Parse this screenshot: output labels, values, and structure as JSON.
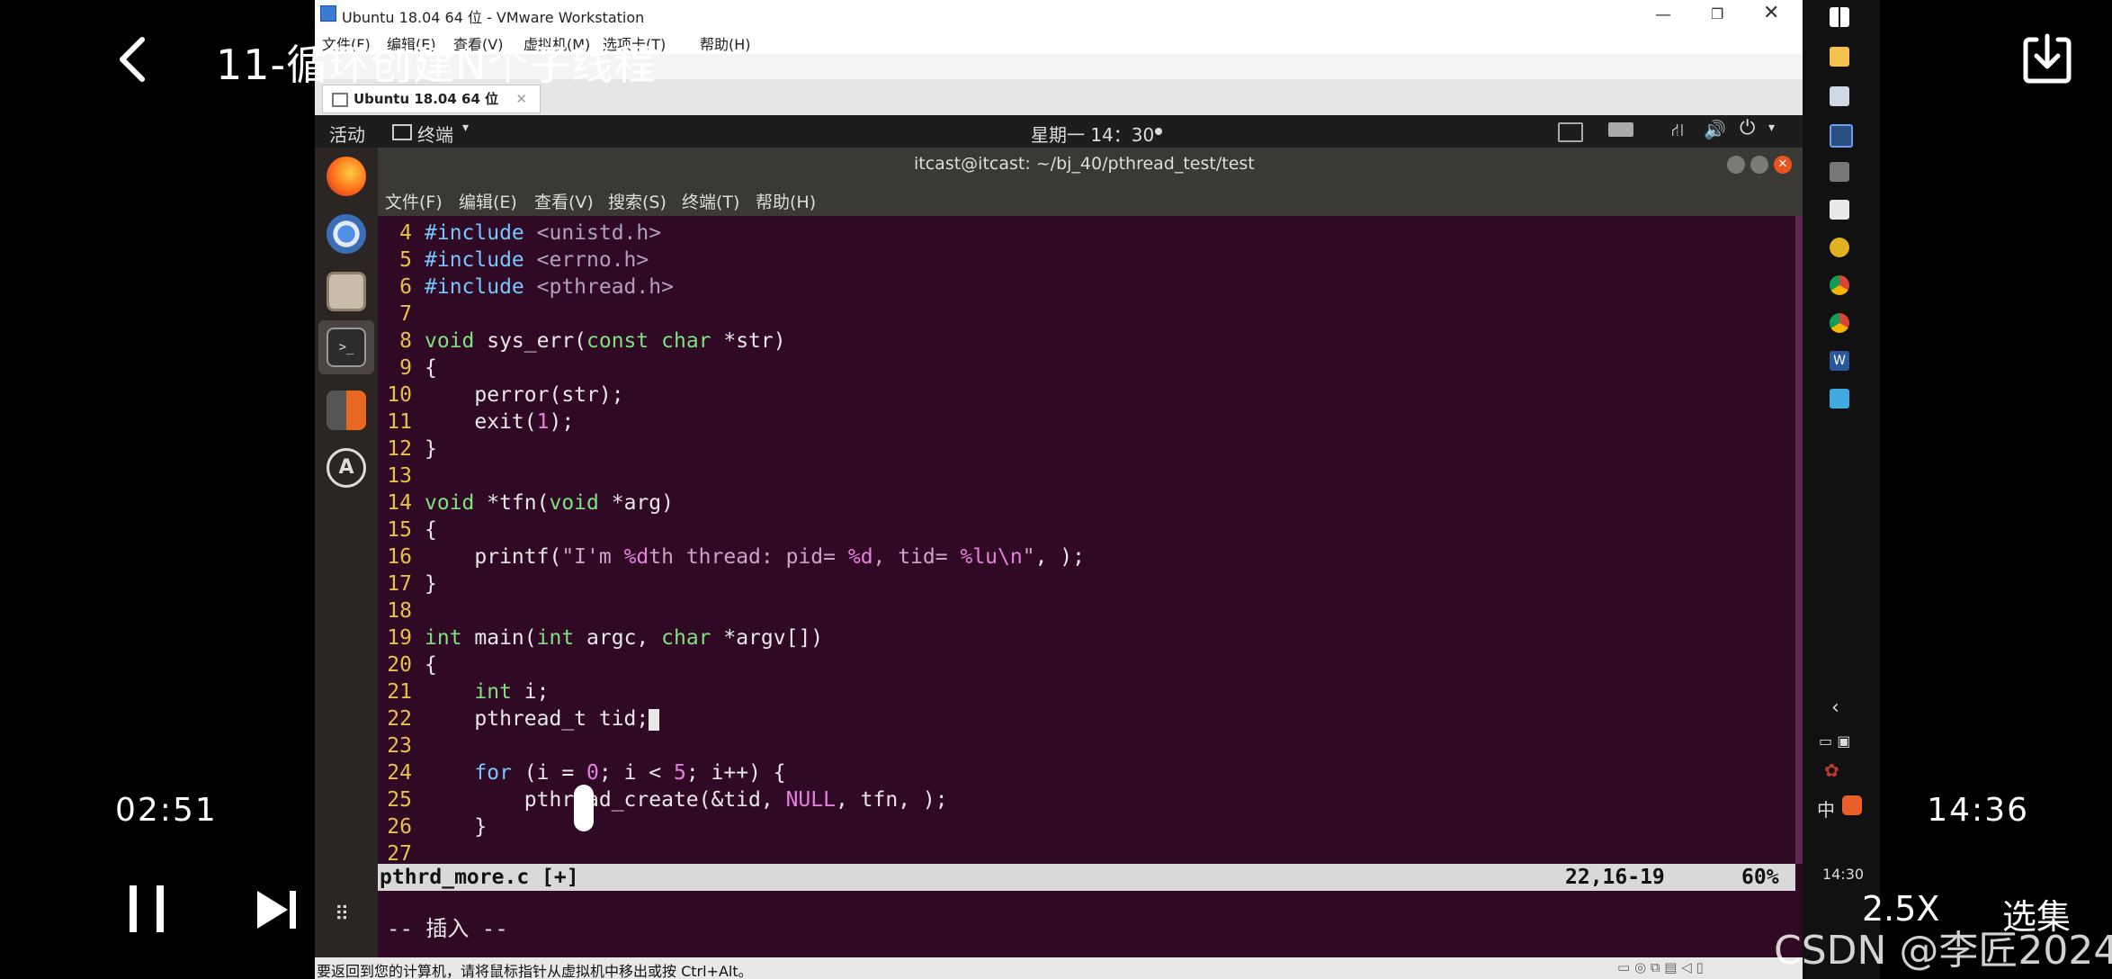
{
  "video": {
    "title": "11-循环创建N个子线程",
    "current_time": "02:51",
    "total_time": "14:36",
    "speed": "2.5X",
    "episodes_label": "选集",
    "watermark": "CSDN @李匠2024"
  },
  "vmware": {
    "window_title": "Ubuntu 18.04 64 位 - VMware Workstation",
    "menu": [
      "文件(F)",
      "编辑(E)",
      "查看(V)",
      "虚拟机(M)",
      "选项卡(T)",
      "帮助(H)"
    ],
    "tab_label": "Ubuntu 18.04 64 位",
    "status_text": "要返回到您的计算机，请将鼠标指针从虚拟机中移出或按 Ctrl+Alt。"
  },
  "ubuntu": {
    "activities": "活动",
    "app_menu": "终端",
    "clock": "星期一 14：30"
  },
  "terminal": {
    "title": "itcast@itcast: ~/bj_40/pthread_test/test",
    "menu": [
      "文件(F)",
      "编辑(E)",
      "查看(V)",
      "搜索(S)",
      "终端(T)",
      "帮助(H)"
    ],
    "lines": [
      {
        "n": "4",
        "segs": [
          {
            "t": "#include",
            "c": "kw"
          },
          {
            "t": " <unistd.h>",
            "c": "pre"
          }
        ]
      },
      {
        "n": "5",
        "segs": [
          {
            "t": "#include",
            "c": "kw"
          },
          {
            "t": " <errno.h>",
            "c": "pre"
          }
        ]
      },
      {
        "n": "6",
        "segs": [
          {
            "t": "#include",
            "c": "kw"
          },
          {
            "t": " <pthread.h>",
            "c": "pre"
          }
        ]
      },
      {
        "n": "7",
        "segs": []
      },
      {
        "n": "8",
        "segs": [
          {
            "t": "void",
            "c": "type"
          },
          {
            "t": " sys_err(",
            "c": "base"
          },
          {
            "t": "const",
            "c": "type"
          },
          {
            "t": " ",
            "c": "base"
          },
          {
            "t": "char",
            "c": "type"
          },
          {
            "t": " *str)",
            "c": "base"
          }
        ]
      },
      {
        "n": "9",
        "segs": [
          {
            "t": "{",
            "c": "base"
          }
        ]
      },
      {
        "n": "10",
        "segs": [
          {
            "t": "    perror(str);",
            "c": "base"
          }
        ]
      },
      {
        "n": "11",
        "segs": [
          {
            "t": "    exit(",
            "c": "base"
          },
          {
            "t": "1",
            "c": "num"
          },
          {
            "t": ");",
            "c": "base"
          }
        ]
      },
      {
        "n": "12",
        "segs": [
          {
            "t": "}",
            "c": "base"
          }
        ]
      },
      {
        "n": "13",
        "segs": []
      },
      {
        "n": "14",
        "segs": [
          {
            "t": "void",
            "c": "type"
          },
          {
            "t": " *tfn(",
            "c": "base"
          },
          {
            "t": "void",
            "c": "type"
          },
          {
            "t": " *arg)",
            "c": "base"
          }
        ]
      },
      {
        "n": "15",
        "segs": [
          {
            "t": "{",
            "c": "base"
          }
        ]
      },
      {
        "n": "16",
        "segs": [
          {
            "t": "    printf(",
            "c": "base"
          },
          {
            "t": "\"I'm ",
            "c": "str"
          },
          {
            "t": "%d",
            "c": "fmt"
          },
          {
            "t": "th thread: pid= ",
            "c": "str"
          },
          {
            "t": "%d",
            "c": "fmt"
          },
          {
            "t": ", tid= ",
            "c": "str"
          },
          {
            "t": "%lu\\n",
            "c": "fmt"
          },
          {
            "t": "\"",
            "c": "str"
          },
          {
            "t": ", );",
            "c": "base"
          }
        ]
      },
      {
        "n": "17",
        "segs": [
          {
            "t": "}",
            "c": "base"
          }
        ]
      },
      {
        "n": "18",
        "segs": []
      },
      {
        "n": "19",
        "segs": [
          {
            "t": "int",
            "c": "type"
          },
          {
            "t": " main(",
            "c": "base"
          },
          {
            "t": "int",
            "c": "type"
          },
          {
            "t": " argc, ",
            "c": "base"
          },
          {
            "t": "char",
            "c": "type"
          },
          {
            "t": " *argv[])",
            "c": "base"
          }
        ]
      },
      {
        "n": "20",
        "segs": [
          {
            "t": "{",
            "c": "base"
          }
        ]
      },
      {
        "n": "21",
        "segs": [
          {
            "t": "    ",
            "c": "base"
          },
          {
            "t": "int",
            "c": "type"
          },
          {
            "t": " i;",
            "c": "base"
          }
        ]
      },
      {
        "n": "22",
        "segs": [
          {
            "t": "    pthread_t tid;",
            "c": "base"
          }
        ],
        "cursor": true
      },
      {
        "n": "23",
        "segs": []
      },
      {
        "n": "24",
        "segs": [
          {
            "t": "    ",
            "c": "base"
          },
          {
            "t": "for",
            "c": "kw"
          },
          {
            "t": " (i = ",
            "c": "base"
          },
          {
            "t": "0",
            "c": "num"
          },
          {
            "t": "; i < ",
            "c": "base"
          },
          {
            "t": "5",
            "c": "num"
          },
          {
            "t": "; i++) {",
            "c": "base"
          }
        ]
      },
      {
        "n": "25",
        "segs": [
          {
            "t": "        pthread_create(&tid, ",
            "c": "base"
          },
          {
            "t": "NULL",
            "c": "num"
          },
          {
            "t": ", tfn, );",
            "c": "base"
          }
        ]
      },
      {
        "n": "26",
        "segs": [
          {
            "t": "    }",
            "c": "base"
          }
        ]
      },
      {
        "n": "27",
        "segs": []
      }
    ],
    "vim_file": "pthrd_more.c [+]",
    "vim_pos": "22,16-19",
    "vim_pct": "60%",
    "vim_mode": "-- 插入 --"
  },
  "taskbar": {
    "ime": "中",
    "clock": "14:30"
  },
  "colors": {
    "terminal_bg": "#300a24",
    "line_number": "#e8c14c",
    "keyword": "#79c4ff",
    "type": "#7fe07f",
    "string": "#c9a6c8"
  }
}
